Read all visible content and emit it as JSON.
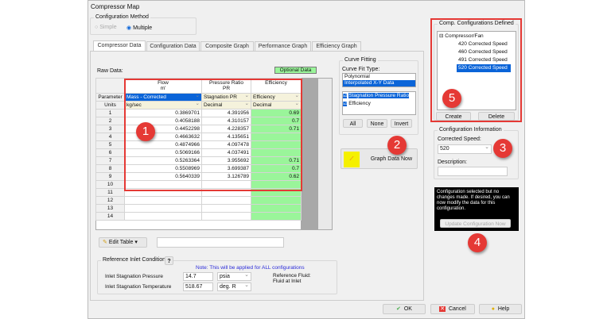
{
  "window": {
    "title": "Compressor Map"
  },
  "config_method": {
    "label": "Configuration Method",
    "options": [
      "Simple",
      "Multiple"
    ],
    "selected": "Multiple"
  },
  "tabs": [
    "Compressor Data",
    "Configuration Data",
    "Composite Graph",
    "Performance Graph",
    "Efficiency Graph"
  ],
  "active_tab": "Compressor Data",
  "raw_data": {
    "label": "Raw Data:",
    "optional": "Optional Data",
    "headers": {
      "flow": "Flow",
      "flow_sub": "m'",
      "pr": "Pressure Ratio",
      "pr_sub": "PR",
      "eff": "Efficiency"
    },
    "parameter_label": "Parameter",
    "units_label": "Units",
    "parameter": [
      "Mass - Corrected",
      "Stagnation PR",
      "Efficiency"
    ],
    "units": [
      "kg/sec",
      "Decimal",
      "Decimal"
    ],
    "rows": [
      {
        "n": "1",
        "flow": "0.3869701",
        "pr": "4.391956",
        "eff": "0.69"
      },
      {
        "n": "2",
        "flow": "0.4058188",
        "pr": "4.310157",
        "eff": "0.7"
      },
      {
        "n": "3",
        "flow": "0.4452298",
        "pr": "4.228357",
        "eff": "0.71"
      },
      {
        "n": "4",
        "flow": "0.4663632",
        "pr": "4.135651",
        "eff": ""
      },
      {
        "n": "5",
        "flow": "0.4874966",
        "pr": "4.097478",
        "eff": ""
      },
      {
        "n": "6",
        "flow": "0.5069166",
        "pr": "4.037491",
        "eff": ""
      },
      {
        "n": "7",
        "flow": "0.5263364",
        "pr": "3.955692",
        "eff": "0.71"
      },
      {
        "n": "8",
        "flow": "0.5508969",
        "pr": "3.699387",
        "eff": "0.7"
      },
      {
        "n": "9",
        "flow": "0.5640339",
        "pr": "3.126789",
        "eff": "0.62"
      },
      {
        "n": "10",
        "flow": "",
        "pr": "",
        "eff": ""
      },
      {
        "n": "11",
        "flow": "",
        "pr": "",
        "eff": ""
      },
      {
        "n": "12",
        "flow": "",
        "pr": "",
        "eff": ""
      },
      {
        "n": "13",
        "flow": "",
        "pr": "",
        "eff": ""
      },
      {
        "n": "14",
        "flow": "",
        "pr": "",
        "eff": ""
      }
    ]
  },
  "curve_fitting": {
    "label": "Curve Fitting",
    "type_label": "Curve Fit Type:",
    "types": [
      "Polynomial",
      "Interpolated X-Y Data"
    ],
    "selected_type": "Interpolated X-Y Data",
    "params": [
      {
        "label": "Stagnation Pressure Ratio",
        "checked": true
      },
      {
        "label": "Efficiency",
        "checked": true
      }
    ],
    "buttons": [
      "All",
      "None",
      "Invert"
    ],
    "graph_button": "Graph Data Now"
  },
  "configs": {
    "label": "Comp. Configurations Defined",
    "root": "Compressor/Fan",
    "items": [
      "420 Corrected Speed",
      "460 Corrected Speed",
      "491 Corrected Speed",
      "520 Corrected Speed"
    ],
    "selected": "520 Corrected Speed",
    "create": "Create",
    "delete": "Delete"
  },
  "config_info": {
    "label": "Configuration Information",
    "speed_label": "Corrected Speed:",
    "speed": "520",
    "desc_label": "Description:",
    "desc": ""
  },
  "notice": {
    "text": "Configuration selected but no changes made. If desired, you can now modify the data for this configuration.",
    "button": "Update Configuration Now"
  },
  "edit_table": "Edit Table",
  "ref_inlet": {
    "label": "Reference Inlet Conditions",
    "help": "?",
    "note": "Note: This will be applied for ALL configurations",
    "pressure_label": "Inlet Stagnation Pressure",
    "pressure": "14.7",
    "pressure_unit": "psia",
    "temp_label": "Inlet Stagnation Temperature",
    "temp": "518.67",
    "temp_unit": "deg. R",
    "fluid_label": "Reference Fluid:",
    "fluid": "Fluid at Inlet"
  },
  "footer": {
    "ok": "OK",
    "cancel": "Cancel",
    "help": "Help"
  },
  "callouts": [
    "1",
    "2",
    "3",
    "4",
    "5"
  ],
  "colors": {
    "callout": "#e53935",
    "selection": "#0a64d8",
    "optional": "#9af59a"
  }
}
